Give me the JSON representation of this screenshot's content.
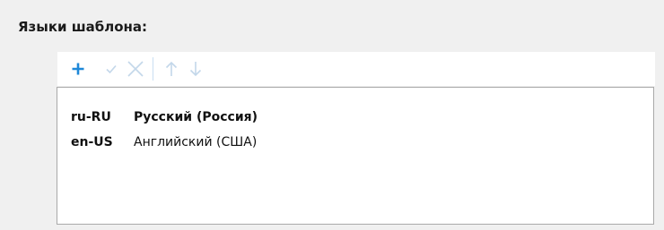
{
  "section": {
    "title": "Языки шаблона:"
  },
  "toolbar": {
    "buttons": [
      {
        "icon": "plus-icon",
        "enabled": true,
        "color": "#1e88d8"
      },
      {
        "icon": "checkmark-icon",
        "enabled": false,
        "color": "#c3d7ea"
      },
      {
        "icon": "close-icon",
        "enabled": false,
        "color": "#c3d7ea"
      },
      {
        "icon": "arrow-up-icon",
        "enabled": false,
        "color": "#c3d7ea"
      },
      {
        "icon": "arrow-down-icon",
        "enabled": false,
        "color": "#c3d7ea"
      }
    ]
  },
  "languages": [
    {
      "code": "ru-RU",
      "name": "Русский (Россия)",
      "selected": true
    },
    {
      "code": "en-US",
      "name": "Английский (США)",
      "selected": false
    }
  ]
}
